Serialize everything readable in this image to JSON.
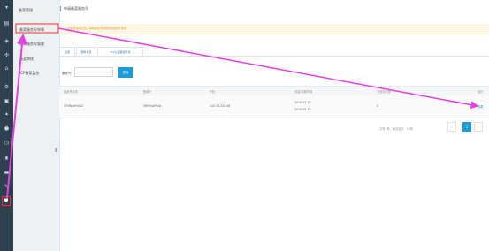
{
  "rail": {
    "icons": [
      "menu-icon",
      "dashboard-icon",
      "shield-icon",
      "arrows-icon",
      "home-icon",
      "settings-icon",
      "document-icon",
      "up-icon",
      "user-icon",
      "clock-icon",
      "lock-icon",
      "server-icon",
      "pen-icon",
      "shield-active-icon"
    ],
    "active_color": "#ff3b3b"
  },
  "submenu": {
    "title": "备案管理",
    "items": [
      "备案服务号申请",
      "备案服务号管理",
      "备案审核",
      "ICP备案监控"
    ]
  },
  "header": {
    "title": "申请备案服务号"
  },
  "notice": {
    "text": "* 如您有任何问题，请联系在线客服或发送邮件咨询。"
  },
  "tabs": [
    "全部",
    "服务审核",
    "ICP认证服务申请",
    "ICP备案服务号审核"
  ],
  "search": {
    "label": "备案号:",
    "placeholder": "",
    "button": "查询"
  },
  "table": {
    "headers": [
      "备案号名称",
      "备案IP",
      "IP段",
      "创建/到期时间",
      "已使用天数",
      "操作"
    ],
    "rows": [
      {
        "name": "CFhRpxPvSaZ",
        "ip": "VRhRpxPvSa",
        "range": "110.76.225.48",
        "created": "2016-03-29",
        "expires": "2016-06-30",
        "days": "0",
        "action": "查看"
      }
    ]
  },
  "pager": {
    "text": "共有1条，每页显示：10条",
    "prev": "‹",
    "first": "«",
    "current": "1",
    "next": "›",
    "last": "»"
  },
  "annotations": {
    "arrow_color": "#e63fe6",
    "highlight_color": "#ff2a2a"
  }
}
